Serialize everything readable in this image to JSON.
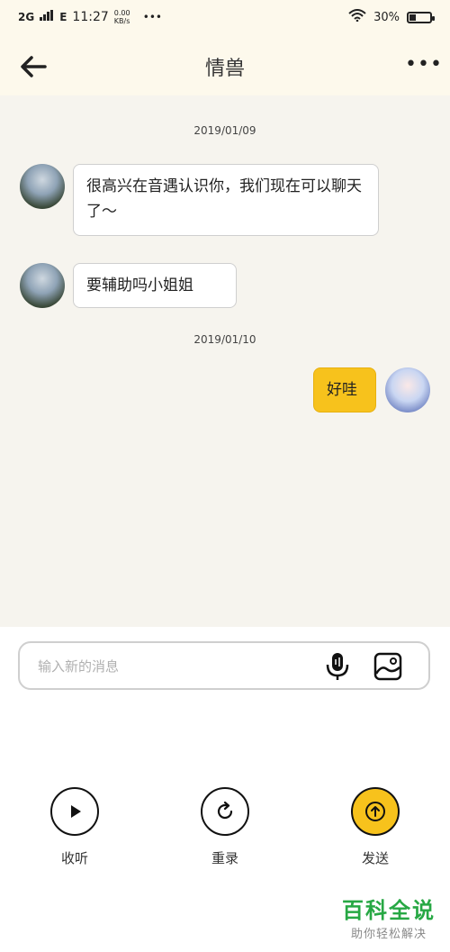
{
  "status_bar": {
    "network": "2G",
    "network2": "E",
    "time": "11:27",
    "speed": "0.00 KB/s",
    "more": "•••",
    "battery_text": "30%",
    "battery_level": 0.3
  },
  "header": {
    "title": "情兽",
    "more_label": "•••"
  },
  "chat": {
    "dates": [
      "2019/01/09",
      "2019/01/10"
    ],
    "messages": [
      {
        "side": "left",
        "text": "很高兴在音遇认识你，我们现在可以聊天了～"
      },
      {
        "side": "left",
        "text": "要辅助吗小姐姐"
      },
      {
        "side": "right",
        "text": "好哇"
      }
    ]
  },
  "composer": {
    "placeholder": "输入新的消息"
  },
  "actions": {
    "listen_label": "收听",
    "rerecord_label": "重录",
    "send_label": "发送"
  },
  "watermark": {
    "title": "百科全说",
    "subtitle": "助你轻松解决"
  },
  "colors": {
    "accent": "#f7c21c",
    "header_bg": "#fdf9ec",
    "chat_bg": "#f6f4ee"
  }
}
